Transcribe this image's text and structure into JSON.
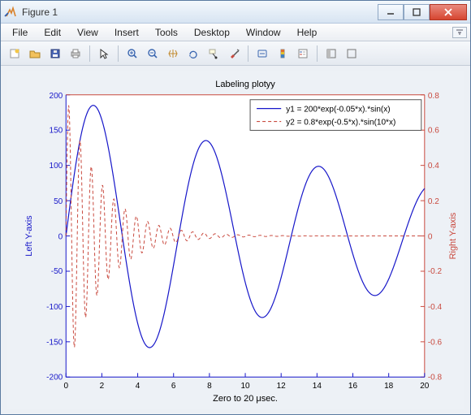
{
  "window": {
    "title": "Figure 1"
  },
  "menus": {
    "file": "File",
    "edit": "Edit",
    "view": "View",
    "insert": "Insert",
    "tools": "Tools",
    "desktop": "Desktop",
    "window_": "Window",
    "help": "Help"
  },
  "chart_data": {
    "type": "line",
    "title": "Labeling plotyy",
    "xlabel": "Zero to 20 μsec.",
    "xlim": [
      0,
      20
    ],
    "xticks": [
      0,
      2,
      4,
      6,
      8,
      10,
      12,
      14,
      16,
      18,
      20
    ],
    "axes": [
      {
        "side": "left",
        "label": "Left Y-axis",
        "color": "#1717c9",
        "ylim": [
          -200,
          200
        ],
        "yticks": [
          -200,
          -150,
          -100,
          -50,
          0,
          50,
          100,
          150,
          200
        ]
      },
      {
        "side": "right",
        "label": "Right Y-axis",
        "color": "#c94a3f",
        "ylim": [
          -0.8,
          0.8
        ],
        "yticks": [
          -0.8,
          -0.6,
          -0.4,
          -0.2,
          0,
          0.2,
          0.4,
          0.6,
          0.8
        ]
      }
    ],
    "legend": {
      "position": "top-right-inside",
      "items": [
        {
          "label": "y1 = 200*exp(-0.05*x).*sin(x)",
          "style": "solid",
          "color": "#1717c9"
        },
        {
          "label": "y2 = 0.8*exp(-0.5*x).*sin(10*x)",
          "style": "dashed",
          "color": "#c94a3f"
        }
      ]
    },
    "series": [
      {
        "name": "y1",
        "axis": "left",
        "color": "#1717c9",
        "style": "solid",
        "formula": "200*exp(-0.05*x)*sin(x)",
        "x_range": [
          0,
          20
        ],
        "sample_values": [
          {
            "x": 0,
            "y": 0
          },
          {
            "x": 1,
            "y": 160.1
          },
          {
            "x": 2,
            "y": 164.6
          },
          {
            "x": 4,
            "y": -123.9
          },
          {
            "x": 5,
            "y": -149.3
          },
          {
            "x": 7,
            "y": 92.6
          },
          {
            "x": 8,
            "y": 132.6
          },
          {
            "x": 10,
            "y": -65.9
          },
          {
            "x": 11,
            "y": -115.4
          },
          {
            "x": 13,
            "y": 43.9
          },
          {
            "x": 14,
            "y": 98.1
          },
          {
            "x": 16,
            "y": -25.9
          },
          {
            "x": 17,
            "y": -81.6
          },
          {
            "x": 19,
            "y": 11.6
          },
          {
            "x": 20,
            "y": 67.1
          }
        ]
      },
      {
        "name": "y2",
        "axis": "right",
        "color": "#c94a3f",
        "style": "dashed",
        "formula": "0.8*exp(-0.5*x)*sin(10*x)",
        "x_range": [
          0,
          20
        ],
        "sample_values": [
          {
            "x": 0,
            "y": 0
          },
          {
            "x": 0.157,
            "y": 0.74
          },
          {
            "x": 0.471,
            "y": -0.63
          },
          {
            "x": 0.785,
            "y": 0.54
          },
          {
            "x": 1.1,
            "y": -0.46
          },
          {
            "x": 1.414,
            "y": 0.39
          },
          {
            "x": 1.728,
            "y": -0.34
          },
          {
            "x": 2.042,
            "y": 0.29
          },
          {
            "x": 2.356,
            "y": -0.25
          },
          {
            "x": 2.67,
            "y": 0.21
          },
          {
            "x": 2.985,
            "y": -0.18
          },
          {
            "x": 3.3,
            "y": 0.15
          },
          {
            "x": 3.927,
            "y": -0.11
          },
          {
            "x": 4.555,
            "y": 0.08
          },
          {
            "x": 5.5,
            "y": -0.05
          },
          {
            "x": 7,
            "y": 0.024
          },
          {
            "x": 9,
            "y": -0.009
          },
          {
            "x": 12,
            "y": 0.002
          },
          {
            "x": 20,
            "y": 0
          }
        ]
      }
    ]
  }
}
